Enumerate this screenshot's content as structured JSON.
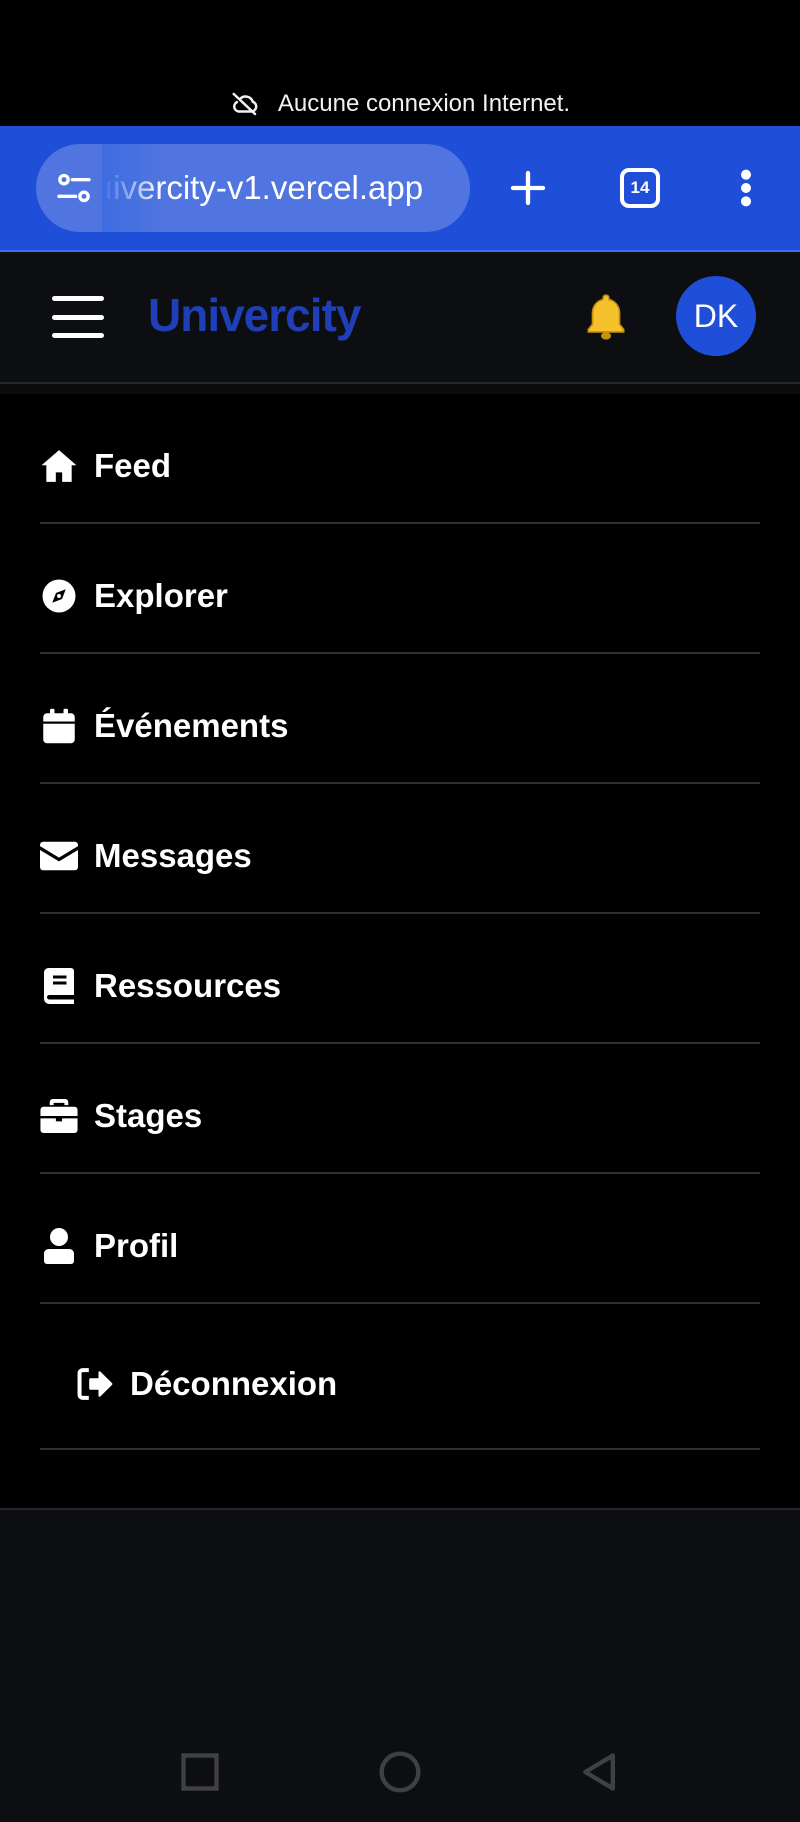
{
  "status": {
    "offline_text": "Aucune connexion Internet.",
    "offline_icon": "cloud-off-icon"
  },
  "browser": {
    "url": "ıivercity-v1.vercel.app",
    "tab_count": "14"
  },
  "header": {
    "brand": "Univercity",
    "avatar_initials": "DK",
    "bell_icon": "🔔"
  },
  "menu": {
    "items": [
      {
        "label": "Feed",
        "icon": "home-icon"
      },
      {
        "label": "Explorer",
        "icon": "compass-icon"
      },
      {
        "label": "Événements",
        "icon": "calendar-icon"
      },
      {
        "label": "Messages",
        "icon": "envelope-icon"
      },
      {
        "label": "Ressources",
        "icon": "book-icon"
      },
      {
        "label": "Stages",
        "icon": "briefcase-icon"
      },
      {
        "label": "Profil",
        "icon": "user-icon"
      }
    ],
    "logout_label": "Déconnexion"
  },
  "colors": {
    "browser_blue": "#1f4fd8",
    "brand_blue": "#1e3fb8",
    "avatar_blue": "#1f4fd8"
  }
}
